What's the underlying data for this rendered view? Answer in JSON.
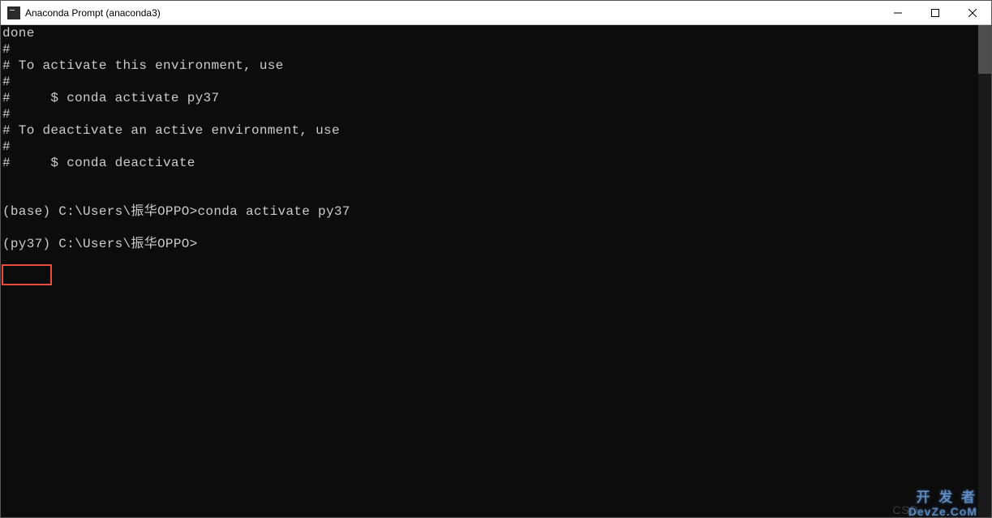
{
  "window": {
    "title": "Anaconda Prompt (anaconda3)"
  },
  "terminal": {
    "lines": [
      "done",
      "#",
      "# To activate this environment, use",
      "#",
      "#     $ conda activate py37",
      "#",
      "# To deactivate an active environment, use",
      "#",
      "#     $ conda deactivate",
      "",
      "",
      "(base) C:\\Users\\振华OPPO>conda activate py37",
      "",
      "(py37) C:\\Users\\振华OPPO>"
    ]
  },
  "watermark": {
    "prefix": "CSD",
    "line1": "开 发 者",
    "line2": "DevZe.CoM"
  }
}
